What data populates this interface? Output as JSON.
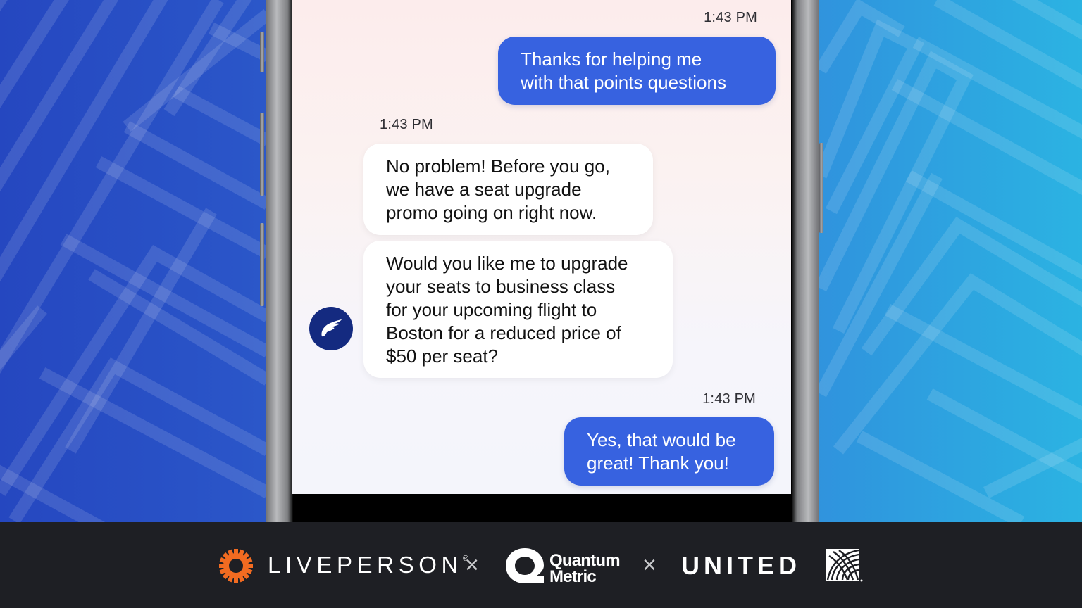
{
  "conversation": {
    "messages": [
      {
        "sender": "user",
        "timestamp": "1:43 PM",
        "lines": [
          "Thanks for helping me",
          "with that points questions"
        ]
      },
      {
        "sender": "agent",
        "timestamp": "1:43 PM",
        "lines": [
          "No problem! Before you go,",
          "we have a seat upgrade",
          "promo going on right now."
        ]
      },
      {
        "sender": "agent",
        "timestamp": "",
        "lines": [
          "Would you like me to upgrade",
          "your seats to business class",
          "for your upcoming flight to",
          "Boston for a reduced price of",
          "$50 per seat?"
        ]
      },
      {
        "sender": "user",
        "timestamp": "1:43 PM",
        "lines": [
          "Yes, that would be",
          "great! Thank you!"
        ]
      }
    ],
    "agent_avatar_icon": "wing-icon"
  },
  "footer": {
    "separator": "×",
    "brands": [
      {
        "name": "LIVEPERSON",
        "registered": "®",
        "icon": "gear-icon",
        "color": "#f26b21"
      },
      {
        "name_lines": [
          "Quantum",
          "Metric"
        ],
        "icon": "quantum-metric-q-icon"
      },
      {
        "name": "UNITED",
        "icon": "globe-icon"
      }
    ]
  },
  "colors": {
    "user_bubble": "#3762e0",
    "agent_bubble": "#ffffff",
    "avatar_bg": "#142a80",
    "footer_bg": "#1e1f24",
    "liveperson_orange": "#f26b21"
  }
}
